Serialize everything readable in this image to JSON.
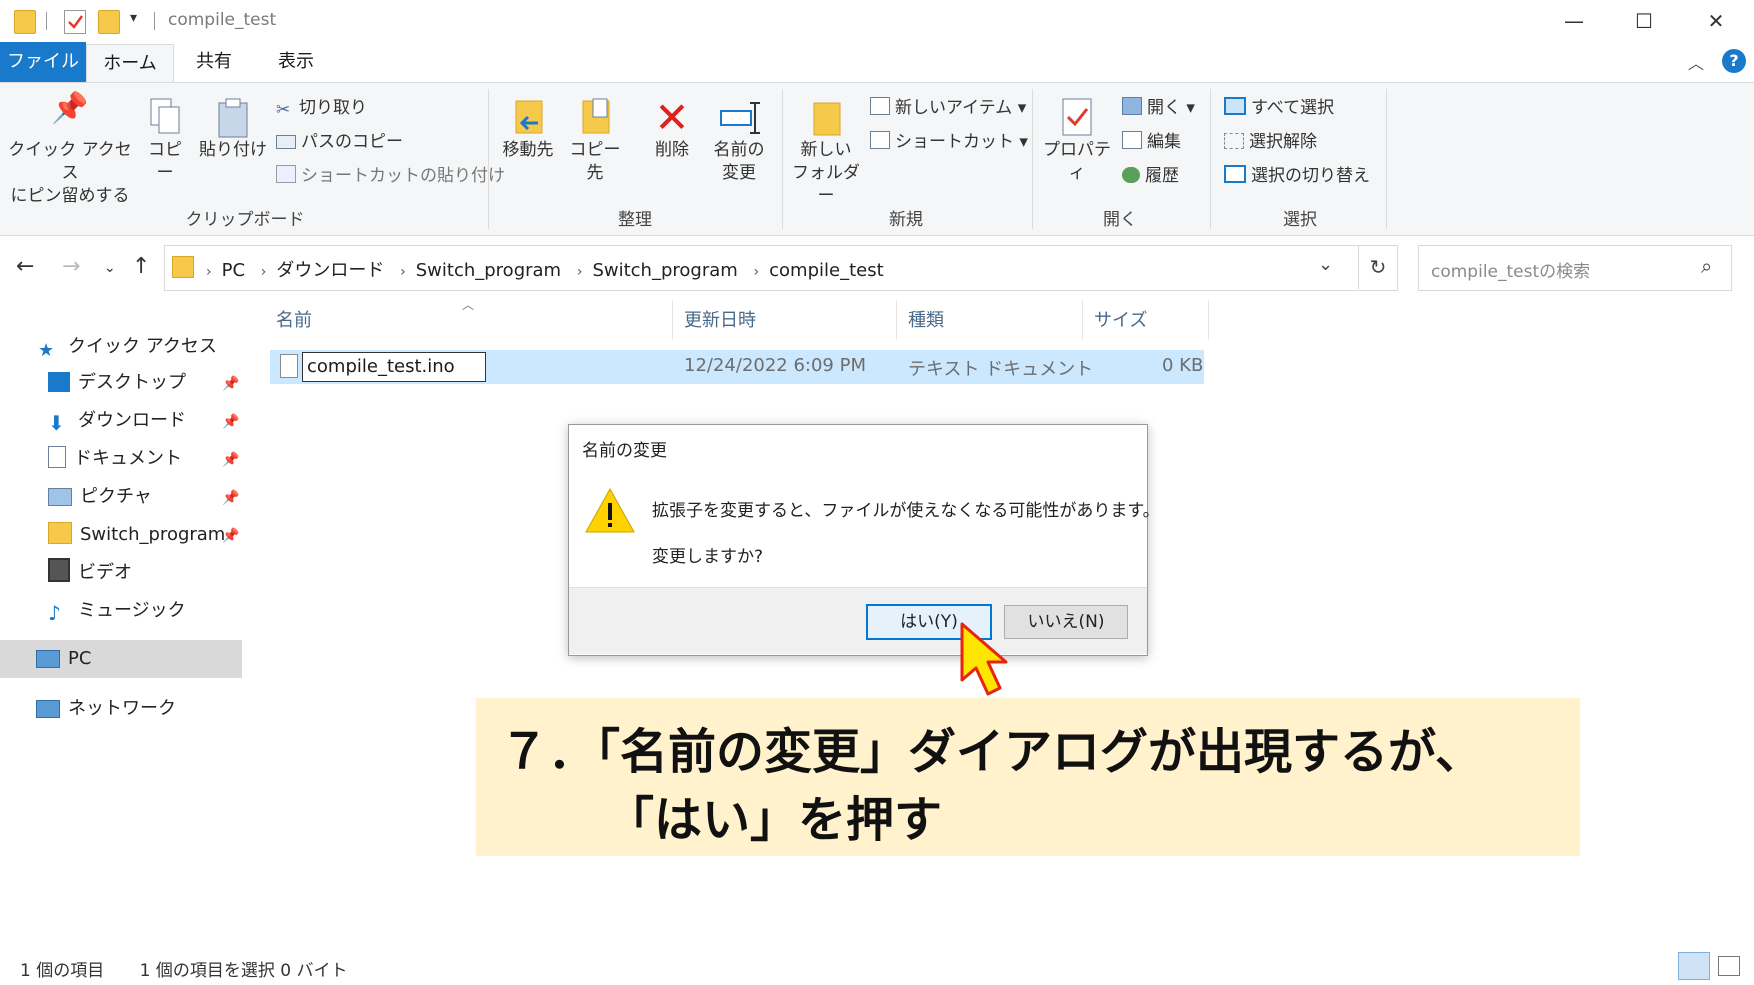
{
  "window": {
    "title": "compile_test",
    "minimize_icon": "minimize-icon",
    "maximize_icon": "maximize-icon",
    "close_icon": "close-icon"
  },
  "tabs": [
    "ファイル",
    "ホーム",
    "共有",
    "表示"
  ],
  "ribbon": {
    "clipboard": {
      "label": "クリップボード",
      "pin_line1": "クイック アクセス",
      "pin_line2": "にピン留めする",
      "copy": "コピー",
      "paste": "貼り付け",
      "cut": "切り取り",
      "copy_path": "パスのコピー",
      "paste_shortcut": "ショートカットの貼り付け"
    },
    "organize": {
      "label": "整理",
      "move_to": "移動先",
      "copy_to": "コピー先",
      "delete": "削除",
      "rename_line1": "名前の",
      "rename_line2": "変更"
    },
    "new": {
      "label": "新規",
      "new_folder_line1": "新しい",
      "new_folder_line2": "フォルダー",
      "new_item": "新しいアイテム",
      "shortcut": "ショートカット"
    },
    "open": {
      "label": "開く",
      "properties": "プロパティ",
      "open": "開く",
      "edit": "編集",
      "history": "履歴"
    },
    "select": {
      "label": "選択",
      "select_all": "すべて選択",
      "select_none": "選択解除",
      "invert": "選択の切り替え"
    }
  },
  "address": {
    "crumbs": [
      "PC",
      "ダウンロード",
      "Switch_program",
      "Switch_program",
      "compile_test"
    ],
    "search_placeholder": "compile_testの検索"
  },
  "sidebar": {
    "quick_access": "クイック アクセス",
    "items": [
      "デスクトップ",
      "ダウンロード",
      "ドキュメント",
      "ピクチャ",
      "Switch_program",
      "ビデオ",
      "ミュージック"
    ],
    "pc": "PC",
    "network": "ネットワーク"
  },
  "columns": [
    "名前",
    "更新日時",
    "種類",
    "サイズ"
  ],
  "file": {
    "name": "compile_test.ino",
    "modified": "12/24/2022 6:09 PM",
    "type": "テキスト ドキュメント",
    "size": "0 KB"
  },
  "dialog": {
    "title": "名前の変更",
    "message1": "拡張子を変更すると、ファイルが使えなくなる可能性があります。",
    "message2": "変更しますか?",
    "yes": "はい(Y)",
    "no": "いいえ(N)"
  },
  "annotation": {
    "line1": "７．「名前の変更」ダイアログが出現するが、",
    "line2": "「はい」を押す"
  },
  "status": {
    "count": "1 個の項目",
    "selected": "1 個の項目を選択  0 バイト"
  }
}
